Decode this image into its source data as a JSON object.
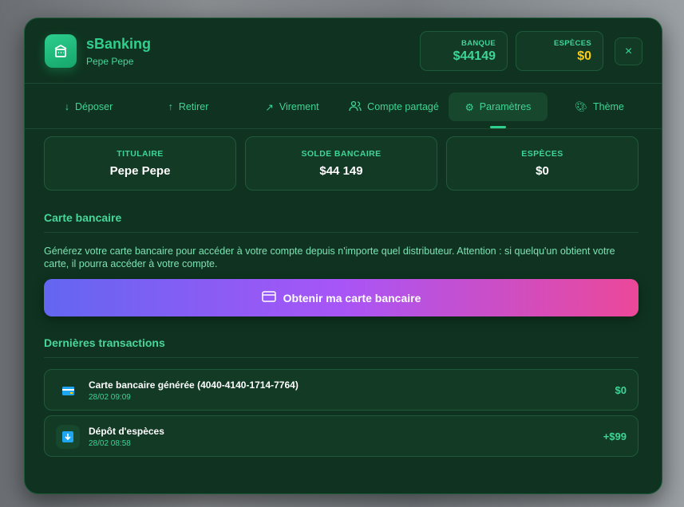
{
  "header": {
    "app_title": "sBanking",
    "user_name": "Pepe Pepe",
    "bank_label": "BANQUE",
    "bank_value": "$44149",
    "cash_label": "ESPÈCES",
    "cash_value": "$0",
    "close": "×"
  },
  "tabs": [
    {
      "label": "Déposer"
    },
    {
      "label": "Retirer"
    },
    {
      "label": "Virement"
    },
    {
      "label": "Compte partagé"
    },
    {
      "label": "Paramètres"
    },
    {
      "label": "Thème"
    }
  ],
  "cards": [
    {
      "label": "TITULAIRE",
      "value": "Pepe Pepe"
    },
    {
      "label": "SOLDE BANCAIRE",
      "value": "$44 149"
    },
    {
      "label": "ESPÈCES",
      "value": "$0"
    }
  ],
  "card_section": {
    "title": "Carte bancaire",
    "description": "Générez votre carte bancaire pour accéder à votre compte depuis n'importe quel distributeur. Attention : si quelqu'un obtient votre carte, il pourra accéder à votre compte.",
    "button": "Obtenir ma carte bancaire"
  },
  "transactions": {
    "title": "Dernières transactions",
    "items": [
      {
        "title": "Carte bancaire générée (4040-4140-1714-7764)",
        "date": "28/02 09:09",
        "amount": "$0"
      },
      {
        "title": "Dépôt d'espèces",
        "date": "28/02 08:58",
        "amount": "+$99"
      }
    ]
  },
  "colors": {
    "accent": "#2fd08d",
    "panel": "#0f3320",
    "cash": "#facc15"
  }
}
